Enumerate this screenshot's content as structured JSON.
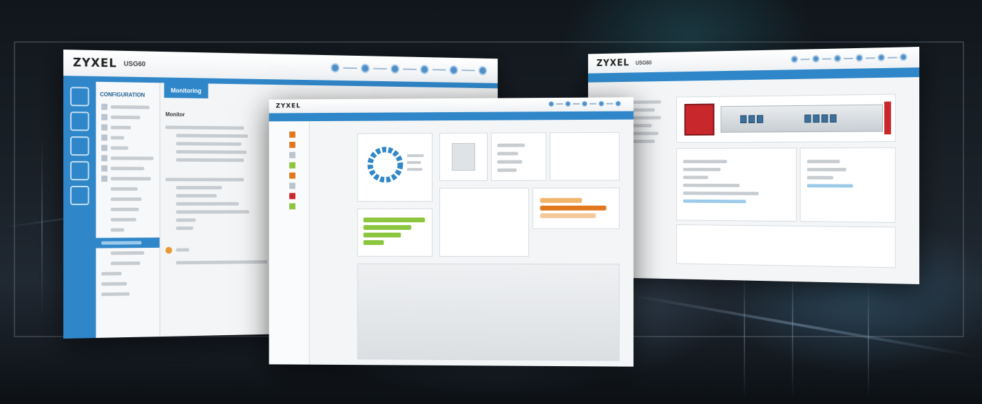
{
  "windows": {
    "left": {
      "logo": "ZYXEL",
      "model": "USG60",
      "tab": "Monitoring",
      "sidebar_title": "CONFIGURATION",
      "status_label": "Monitor"
    },
    "right": {
      "logo": "ZYXEL",
      "model": "USG60"
    },
    "center": {
      "logo": "ZYXEL"
    }
  },
  "icons": [
    "monitor-icon",
    "settings-icon",
    "search-icon",
    "gear-icon",
    "users-icon",
    "network-icon"
  ],
  "colors": {
    "accent": "#2f87c9",
    "device_red": "#c8272c",
    "chart_green": "#8cc63f",
    "chart_orange": "#e2781e"
  }
}
